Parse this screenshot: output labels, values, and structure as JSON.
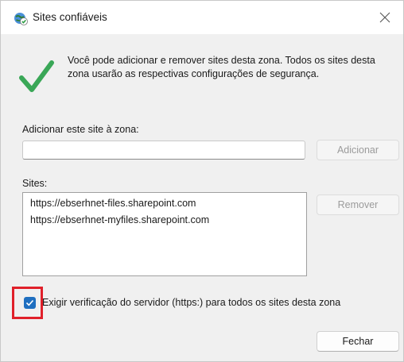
{
  "window": {
    "title": "Sites confiáveis",
    "icon": "globe-check-icon",
    "close_icon": "close-icon"
  },
  "intro": {
    "icon": "green-checkmark-icon",
    "text": "Você pode adicionar e remover sites desta zona. Todos os sites desta zona usarão as respectivas configurações de segurança."
  },
  "add_site": {
    "label": "Adicionar este site à zona:",
    "value": "",
    "button": "Adicionar"
  },
  "sites": {
    "label": "Sites:",
    "items": [
      "https://ebserhnet-files.sharepoint.com",
      "https://ebserhnet-myfiles.sharepoint.com"
    ],
    "remove_button": "Remover"
  },
  "require_https": {
    "checked": true,
    "label": "Exigir verificação do servidor (https:) para todos os sites desta zona"
  },
  "footer": {
    "close_button": "Fechar"
  },
  "colors": {
    "checkbox_accent": "#1f6fc0",
    "highlight": "#e0202a",
    "check_green": "#3aa757"
  }
}
